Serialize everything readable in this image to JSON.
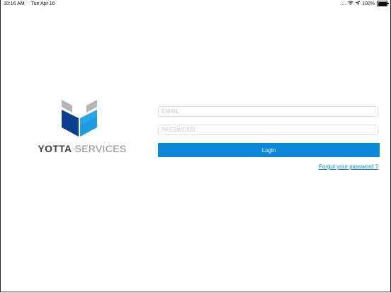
{
  "status_bar": {
    "time": "10:16 AM",
    "date": "Tue Apr 16",
    "signal_dots": "....",
    "battery_percent": "100%",
    "battery_level": 1.0,
    "icons": [
      "wifi-icon",
      "location-arrow-icon",
      "battery-icon"
    ]
  },
  "logo": {
    "brand_bold": "YOTTA",
    "brand_light": " SERVICES",
    "colors": {
      "cube_dark_blue": "#0d3d8f",
      "cube_light_blue": "#1b9be0",
      "cube_gray": "#b5b5b5"
    }
  },
  "login_form": {
    "email_placeholder": "EMAIL",
    "email_value": "",
    "password_placeholder": "PASSWORD",
    "password_value": "",
    "login_label": "Login",
    "forgot_label": "Forgot your password ?"
  },
  "colors": {
    "accent": "#0a87d6",
    "field_border": "#dedede"
  }
}
